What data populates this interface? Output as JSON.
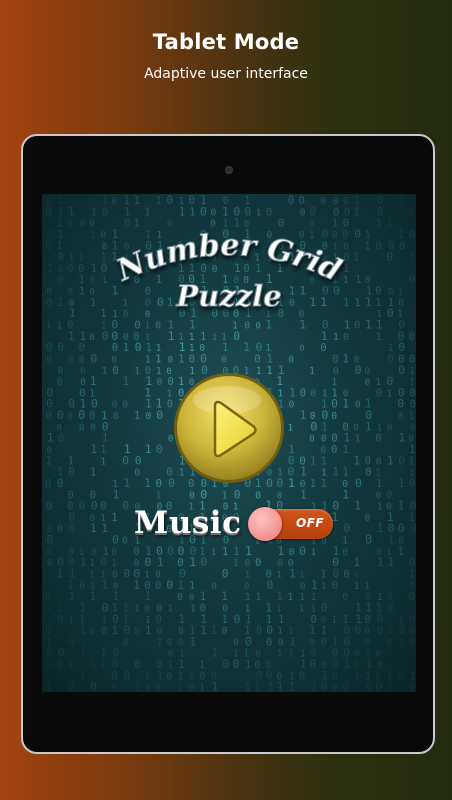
{
  "promo": {
    "title": "Tablet Mode",
    "subtitle": "Adaptive user interface"
  },
  "game": {
    "title_line1": "Number Grid",
    "title_line2": "Puzzle",
    "play_icon": "play-triangle",
    "music_label": "Music",
    "music_toggle_state": "OFF",
    "background_digits": "0 1"
  },
  "colors": {
    "bg_left": "#a34310",
    "bg_right": "#222a10",
    "screen_bg": "#123a3f",
    "digits": "#5ad0d8",
    "play_button": "#c9b43a",
    "play_triangle": "#f0e040",
    "toggle_off": "#c44b14",
    "toggle_knob": "#f5a0a0"
  }
}
